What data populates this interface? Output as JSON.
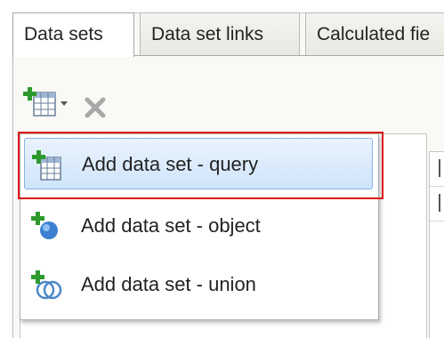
{
  "header": {
    "cut_title": "DATA SETS"
  },
  "tabs": [
    {
      "label": "Data sets",
      "active": true
    },
    {
      "label": "Data set links",
      "active": false
    },
    {
      "label": "Calculated fie",
      "active": false
    }
  ],
  "toolbar": {
    "add_icon": "add-data-set-icon",
    "delete_icon": "delete-icon"
  },
  "menu": {
    "items": [
      {
        "label": "Add data set - query",
        "icon": "query-table-icon",
        "highlighted": true
      },
      {
        "label": "Add data set - object",
        "icon": "object-sphere-icon",
        "highlighted": false
      },
      {
        "label": "Add data set - union",
        "icon": "union-icon",
        "highlighted": false
      }
    ]
  },
  "colors": {
    "highlight_border": "#e0141a",
    "menu_hover": "#cfe4fb",
    "add_green": "#2e9a2e"
  }
}
